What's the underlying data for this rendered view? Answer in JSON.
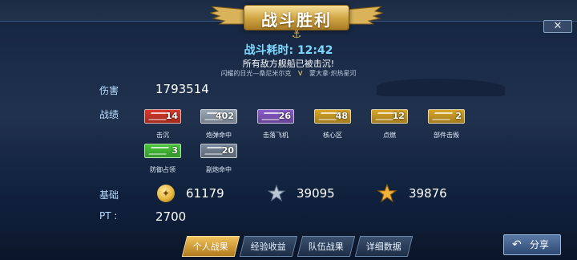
{
  "header": {
    "title": "战斗胜利",
    "close_label": "✕"
  },
  "battle": {
    "duration_text": "战斗耗时: 12:42",
    "result_text": "所有敌方舰船已被击沉!",
    "player_left": "闪耀的日光—桑尼米尔克",
    "versus": "V",
    "player_right": "蒙大拿·炽热星河"
  },
  "damage": {
    "label": "伤害",
    "value": "1793514"
  },
  "record": {
    "label": "战绩",
    "medals": [
      {
        "caption": "击沉",
        "count": "14",
        "color": "#d83a2c",
        "icon": "sink-icon"
      },
      {
        "caption": "炮弹命中",
        "count": "402",
        "color": "#9aa8b8",
        "icon": "shell-hit-icon"
      },
      {
        "caption": "击落飞机",
        "count": "26",
        "color": "#8a5cc8",
        "icon": "plane-down-icon"
      },
      {
        "caption": "核心区",
        "count": "48",
        "color": "#d8a628",
        "icon": "citadel-icon"
      },
      {
        "caption": "点燃",
        "count": "12",
        "color": "#d8a628",
        "icon": "fire-icon"
      },
      {
        "caption": "部件击毁",
        "count": "2",
        "color": "#d8a628",
        "icon": "module-icon"
      },
      {
        "caption": "防御占领",
        "count": "3",
        "color": "#48c83a",
        "icon": "defend-icon"
      },
      {
        "caption": "副炮命中",
        "count": "20",
        "color": "#7a8a9c",
        "icon": "secondary-icon"
      }
    ]
  },
  "base": {
    "label": "基础",
    "stats": [
      {
        "icon": "coin-icon",
        "value": "61179"
      },
      {
        "icon": "silver-star-icon",
        "value": "39095"
      },
      {
        "icon": "gold-star-icon",
        "value": "39876"
      }
    ]
  },
  "pt": {
    "label": "PT :",
    "value": "2700"
  },
  "tabs": [
    {
      "label": "个人战果",
      "active": true
    },
    {
      "label": "经验收益",
      "active": false
    },
    {
      "label": "队伍战果",
      "active": false
    },
    {
      "label": "详细数据",
      "active": false
    }
  ],
  "share": {
    "label": "分享"
  }
}
